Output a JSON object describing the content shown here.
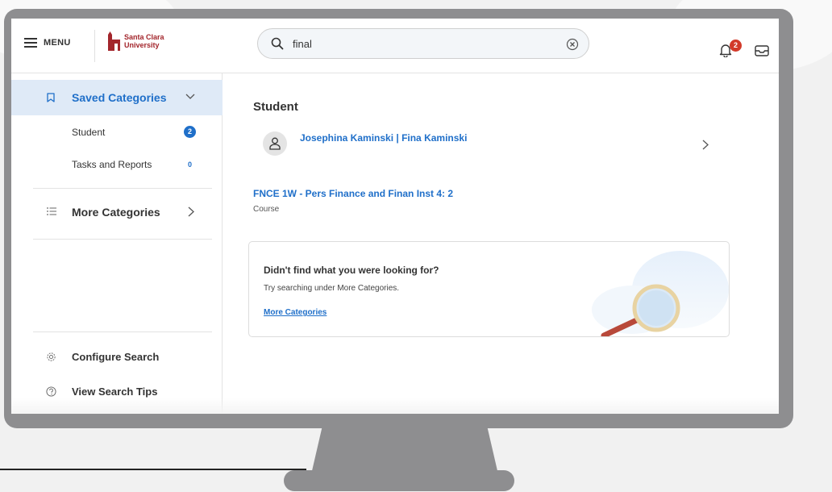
{
  "topbar": {
    "menu_label": "MENU",
    "logo_line1": "Santa Clara",
    "logo_line2": "University",
    "search_value": "final",
    "notification_count": "2"
  },
  "sidebar": {
    "saved_categories_label": "Saved Categories",
    "saved_items": [
      {
        "label": "Student",
        "count": "2"
      },
      {
        "label": "Tasks and Reports",
        "count": "0"
      }
    ],
    "more_categories_label": "More Categories",
    "configure_search_label": "Configure Search",
    "view_search_tips_label": "View Search Tips"
  },
  "main": {
    "section_title": "Student",
    "person_result": "Josephina Kaminski | Fina Kaminski",
    "course_result": {
      "title": "FNCE 1W - Pers Finance and Finan Inst 4: 2",
      "type": "Course"
    },
    "hint": {
      "title": "Didn't find what you were looking for?",
      "text": "Try searching under More Categories.",
      "link": "More Categories"
    }
  },
  "colors": {
    "accent": "#1f6fc9",
    "brand": "#a3262c",
    "alert": "#d23a2a",
    "selected_bg": "#dfeaf7",
    "monitor": "#8e8e90"
  }
}
